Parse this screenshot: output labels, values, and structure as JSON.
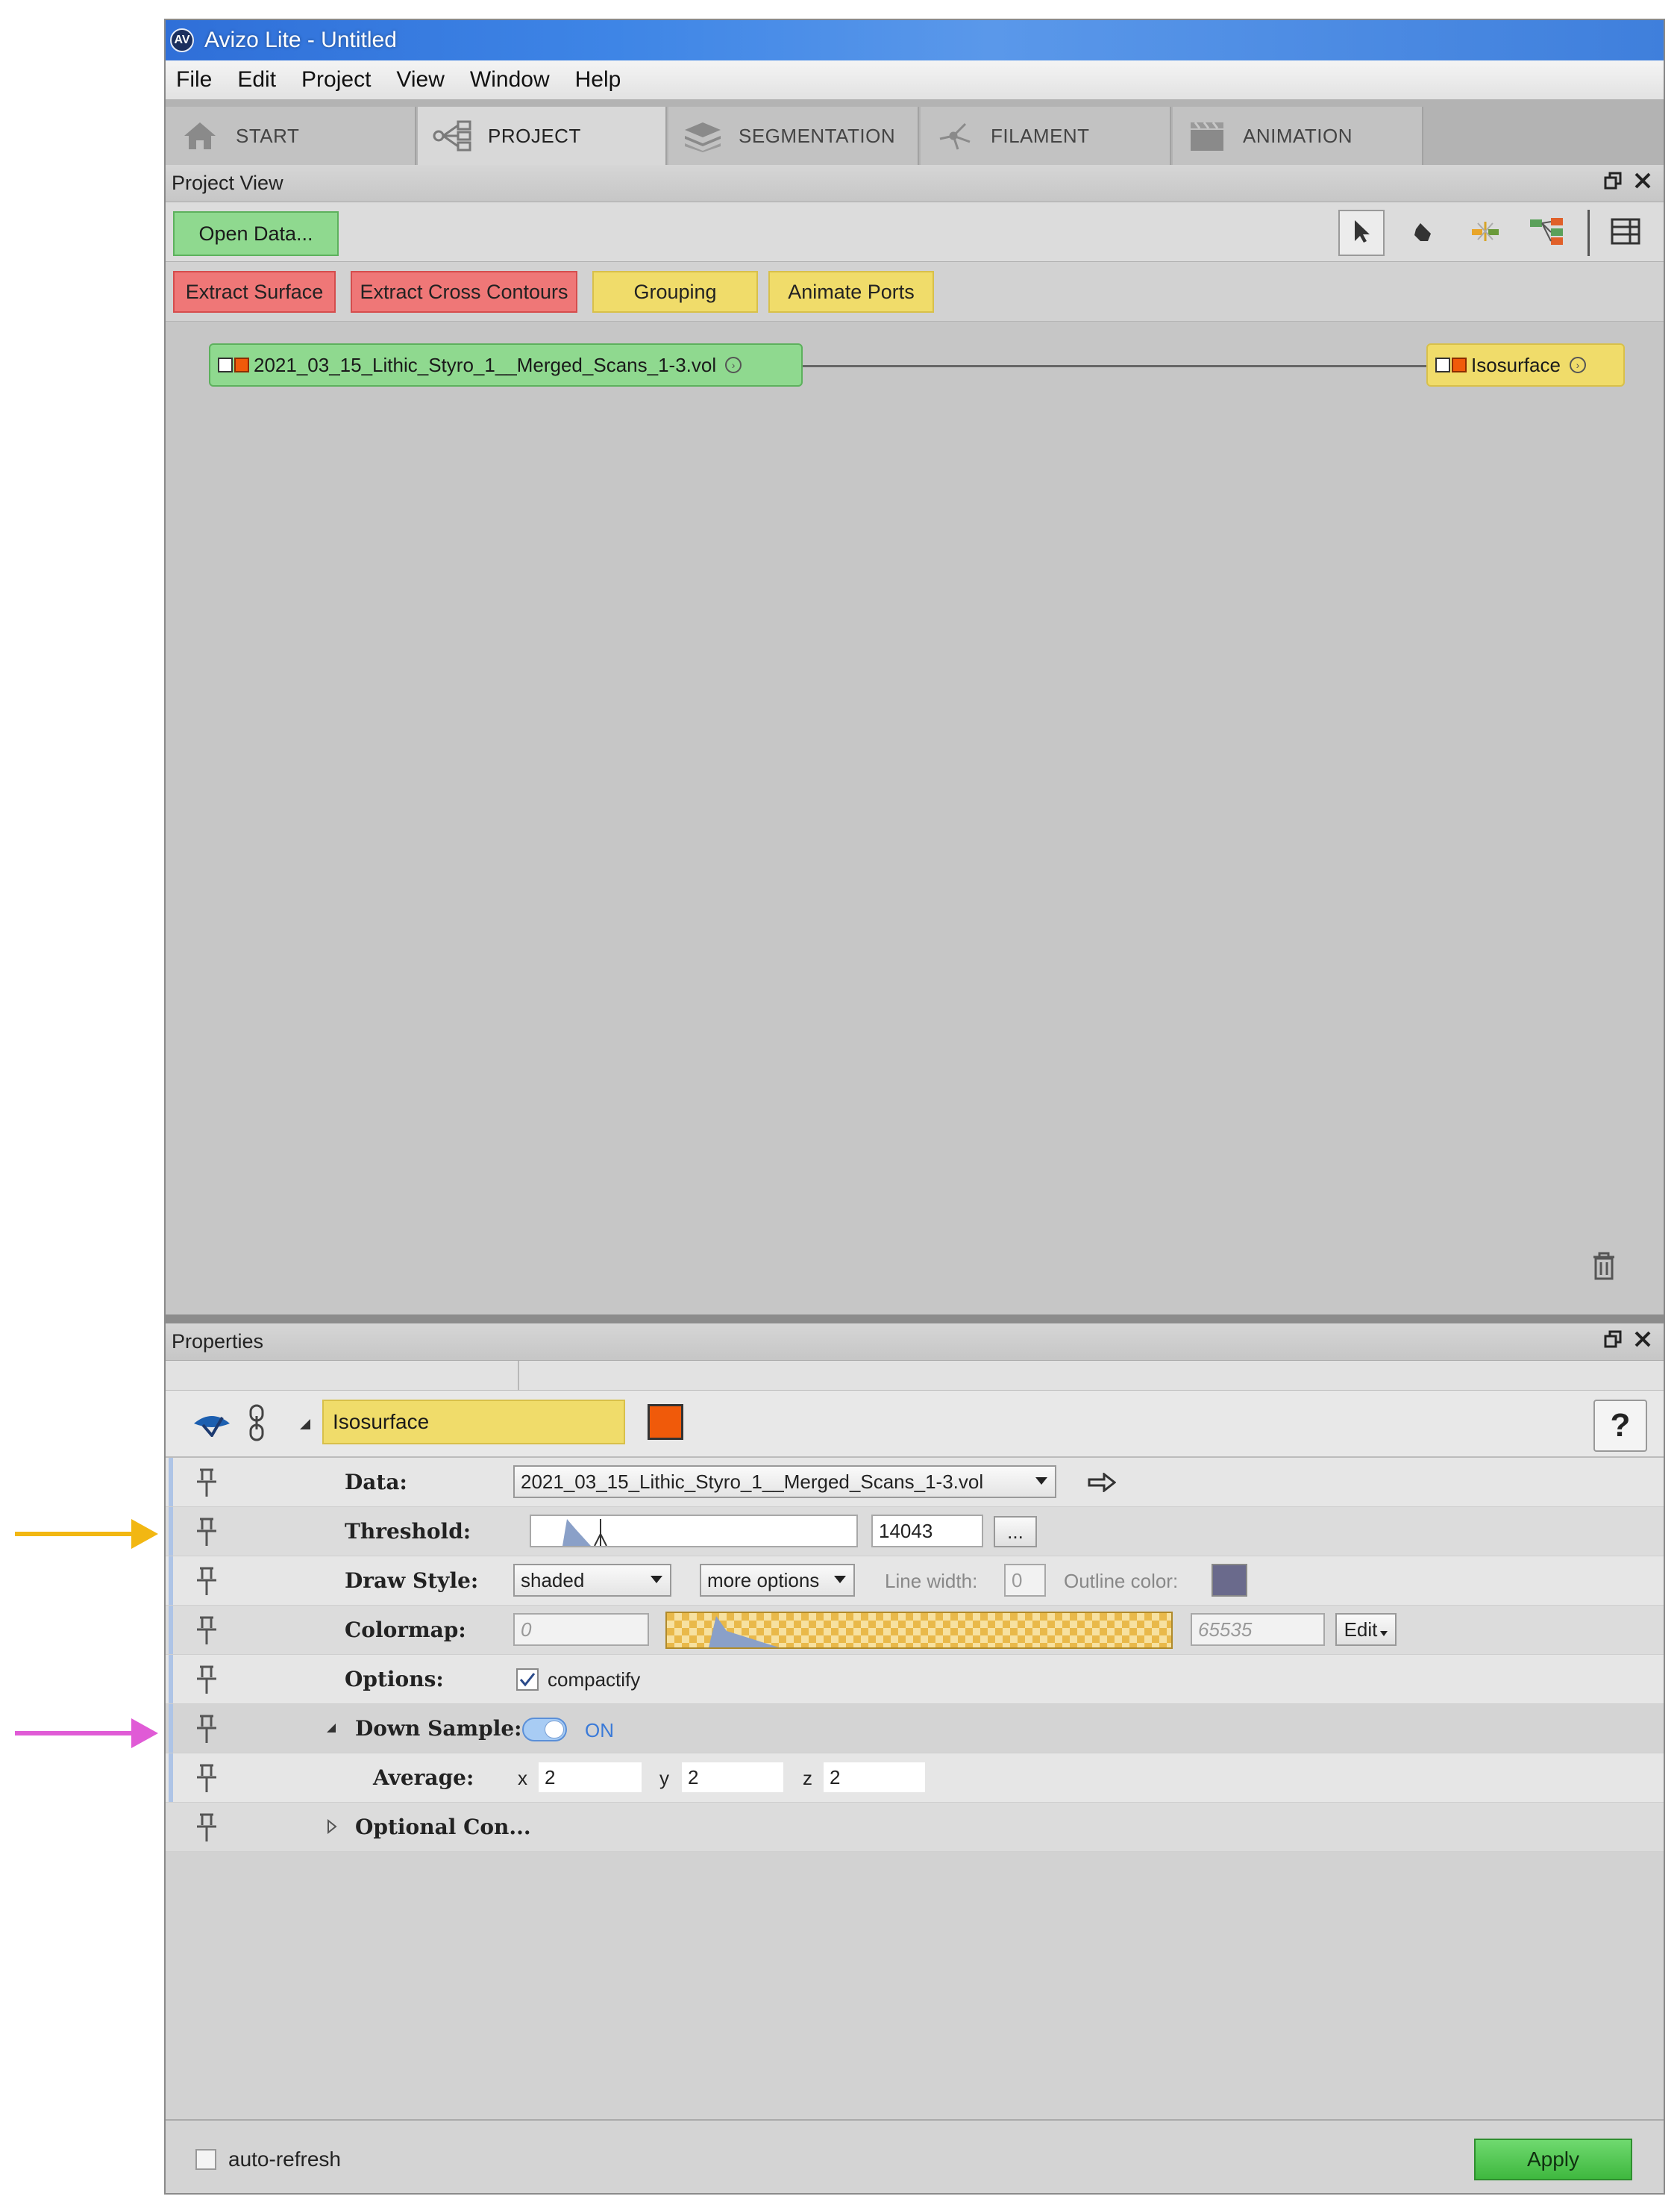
{
  "window": {
    "title": "Avizo Lite - Untitled",
    "logo_text": "AV"
  },
  "menu": [
    "File",
    "Edit",
    "Project",
    "View",
    "Window",
    "Help"
  ],
  "tabs": [
    {
      "label": "START",
      "icon": "home-icon"
    },
    {
      "label": "PROJECT",
      "icon": "project-graph-icon",
      "active": true
    },
    {
      "label": "SEGMENTATION",
      "icon": "layers-icon"
    },
    {
      "label": "FILAMENT",
      "icon": "filament-icon"
    },
    {
      "label": "ANIMATION",
      "icon": "clapperboard-icon"
    }
  ],
  "project_view": {
    "title": "Project View",
    "open_data_label": "Open Data...",
    "macro_buttons": [
      {
        "label": "Extract Surface",
        "color": "red"
      },
      {
        "label": "Extract Cross Contours",
        "color": "red"
      },
      {
        "label": "Grouping",
        "color": "yellow"
      },
      {
        "label": "Animate Ports",
        "color": "yellow"
      }
    ],
    "data_node_label": "2021_03_15_Lithic_Styro_1__Merged_Scans_1-3.vol",
    "iso_node_label": "Isosurface"
  },
  "properties": {
    "title": "Properties",
    "module_name": "Isosurface",
    "help_label": "?",
    "data_label": "Data:",
    "data_value": "2021_03_15_Lithic_Styro_1__Merged_Scans_1-3.vol",
    "threshold_label": "Threshold:",
    "threshold_value": "14043",
    "threshold_fraction": 0.214,
    "threshold_more": "...",
    "drawstyle_label": "Draw Style:",
    "drawstyle_value": "shaded",
    "more_options_label": "more options",
    "linewidth_label": "Line width:",
    "linewidth_value": "0",
    "outline_color_label": "Outline color:",
    "outline_color": "#6a6a8c",
    "colormap_label": "Colormap:",
    "colormap_min": "0",
    "colormap_max": "65535",
    "colormap_edit": "Edit",
    "options_label": "Options:",
    "compactify_label": "compactify",
    "downsample_label": "Down Sample:",
    "downsample_state": "ON",
    "average_label": "Average:",
    "avg_x_label": "x",
    "avg_x": "2",
    "avg_y_label": "y",
    "avg_y": "2",
    "avg_z_label": "z",
    "avg_z": "2",
    "optional_label": "Optional Con..."
  },
  "footer": {
    "auto_refresh_label": "auto-refresh",
    "apply_label": "Apply"
  },
  "colors": {
    "data_node": "#8fd98f",
    "module_yellow": "#f0dc6a",
    "macro_red": "#ef7777",
    "accent_orange": "#f05a0a",
    "annotation_yellow": "#f2b712",
    "annotation_magenta": "#e05bd6",
    "apply_green": "#4fc24f"
  }
}
